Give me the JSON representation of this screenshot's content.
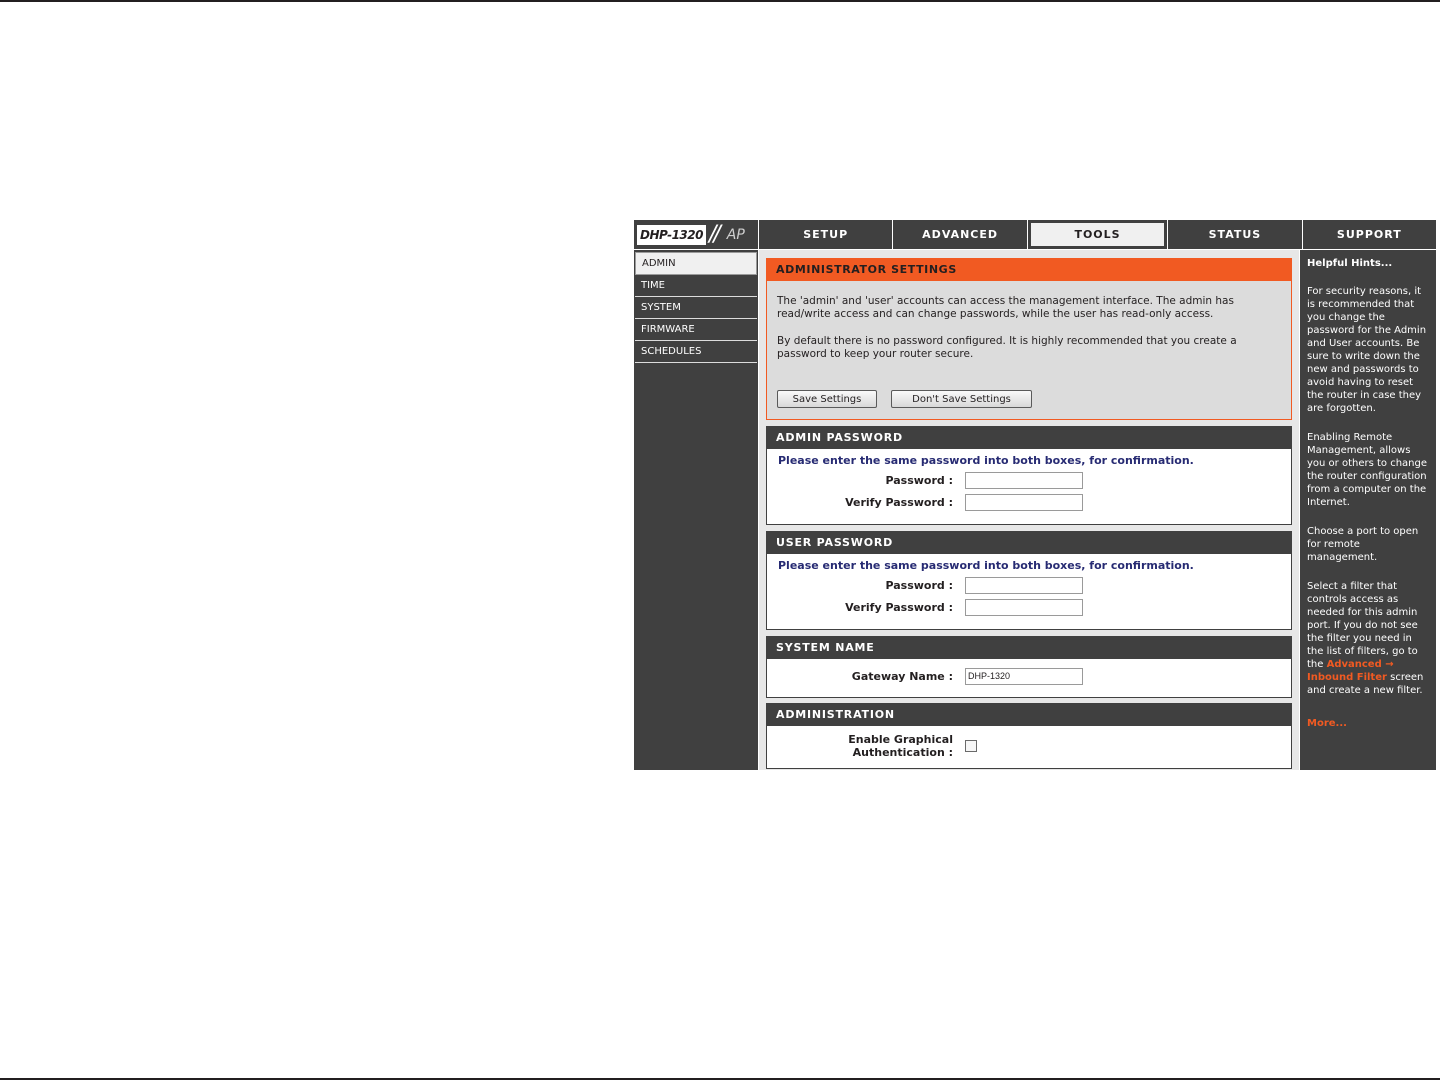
{
  "brand": {
    "model": "DHP-1320",
    "slash": "//",
    "suffix": "AP"
  },
  "tabs": [
    {
      "label": "SETUP",
      "active": false
    },
    {
      "label": "ADVANCED",
      "active": false
    },
    {
      "label": "TOOLS",
      "active": true
    },
    {
      "label": "STATUS",
      "active": false
    },
    {
      "label": "SUPPORT",
      "active": false
    }
  ],
  "leftnav": [
    {
      "label": "ADMIN",
      "active": true
    },
    {
      "label": "TIME",
      "active": false
    },
    {
      "label": "SYSTEM",
      "active": false
    },
    {
      "label": "FIRMWARE",
      "active": false
    },
    {
      "label": "SCHEDULES",
      "active": false
    }
  ],
  "admin": {
    "title": "ADMINISTRATOR SETTINGS",
    "para1": "The 'admin' and 'user' accounts can access the management interface. The admin has read/write access and can change passwords, while the user has read-only access.",
    "para2": "By default there is no password configured. It is highly recommended that you create a password to keep your router secure.",
    "save_label": "Save Settings",
    "dont_save_label": "Don't Save Settings"
  },
  "admin_password": {
    "title": "ADMIN PASSWORD",
    "hint": "Please enter the same password into both boxes, for confirmation.",
    "password_label": "Password :",
    "verify_label": "Verify Password :"
  },
  "user_password": {
    "title": "USER PASSWORD",
    "hint": "Please enter the same password into both boxes, for confirmation.",
    "password_label": "Password :",
    "verify_label": "Verify Password :"
  },
  "system_name": {
    "title": "SYSTEM NAME",
    "gateway_label": "Gateway Name :",
    "gateway_value": "DHP-1320"
  },
  "administration": {
    "title": "ADMINISTRATION",
    "graphical_auth_label_1": "Enable Graphical",
    "graphical_auth_label_2": "Authentication :",
    "graphical_auth_checked": false
  },
  "hints": {
    "title": "Helpful Hints...",
    "p1": "For security reasons, it is recommended that you change the password for the Admin and User accounts. Be sure to write down the new and passwords to avoid having to reset the router in case they are forgotten.",
    "p2": "Enabling Remote Management, allows you or others to change the router configuration from a computer on the Internet.",
    "p3": "Choose a port to open for remote management.",
    "p4_pre": "Select a filter that controls access as needed for this admin port. If you do not see the filter you need in the list of filters, go to the ",
    "p4_link": "Advanced → Inbound Filter",
    "p4_post": " screen and create a new filter.",
    "more": "More..."
  },
  "colors": {
    "accent": "#f15a22",
    "dark": "#404040",
    "hint_blue": "#272b73",
    "panel": "#e7e7e7"
  }
}
